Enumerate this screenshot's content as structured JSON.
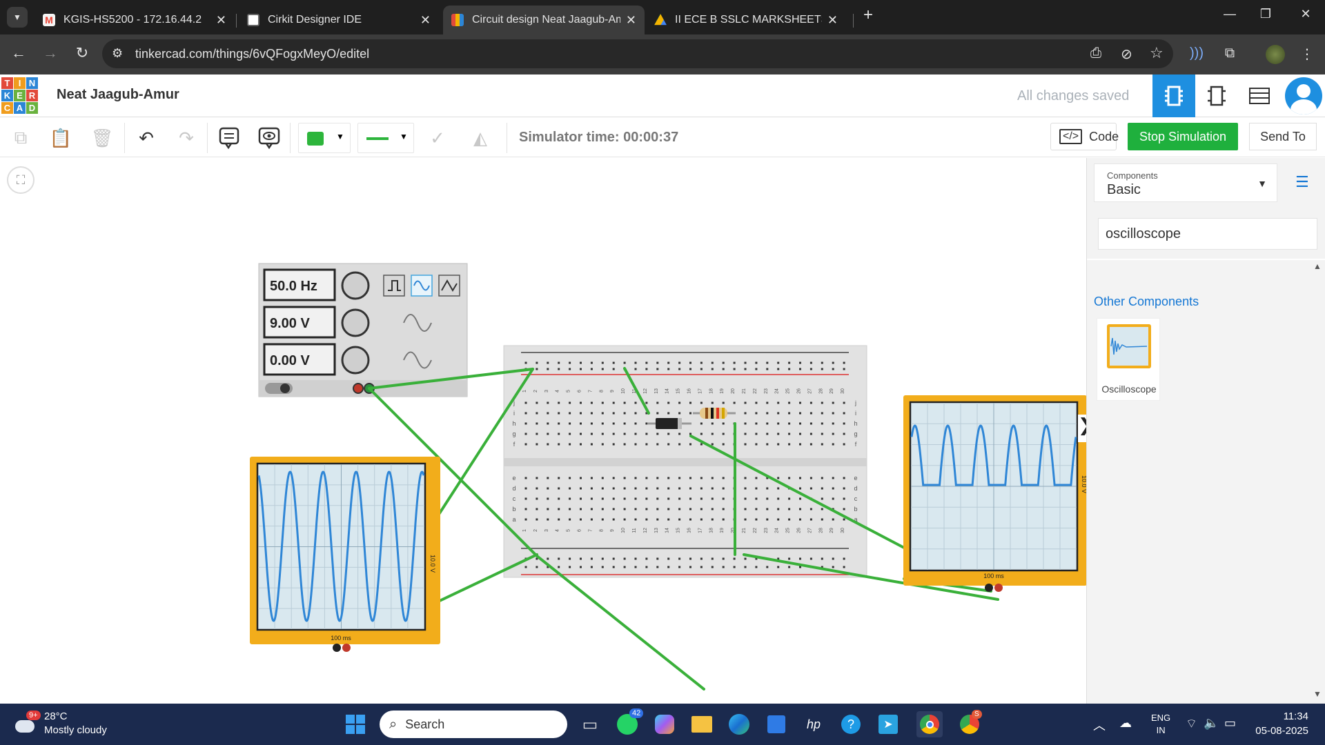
{
  "browser": {
    "tabs": [
      {
        "title": "KGIS-HS5200 - 172.16.44.2",
        "icon": "gmail-icon",
        "active": false
      },
      {
        "title": "Cirkit Designer IDE",
        "icon": "cirkit-icon",
        "active": false
      },
      {
        "title": "Circuit design Neat Jaagub-Amur",
        "icon": "tinkercad-icon",
        "active": true
      },
      {
        "title": "II ECE B SSLC MARKSHEETS - Go",
        "icon": "drive-icon",
        "active": false
      }
    ],
    "url": "tinkercad.com/things/6vQFogxMeyO/editel"
  },
  "header": {
    "logo_letters": [
      "T",
      "I",
      "N",
      "K",
      "E",
      "R",
      "C",
      "A",
      "D"
    ],
    "project_title": "Neat Jaagub-Amur",
    "save_status": "All changes saved"
  },
  "toolbar": {
    "simulator_time": "Simulator time: 00:00:37",
    "code_label": "Code",
    "stop_label": "Stop Simulation",
    "send_label": "Send To",
    "color_swatch": "#2db53c"
  },
  "function_generator": {
    "frequency": "50.0 Hz",
    "amplitude": "9.00 V",
    "offset": "0.00 V"
  },
  "breadboard": {
    "columns": [
      "1",
      "2",
      "3",
      "4",
      "5",
      "6",
      "7",
      "8",
      "9",
      "10",
      "11",
      "12",
      "13",
      "14",
      "15",
      "16",
      "17",
      "18",
      "19",
      "20",
      "21",
      "22",
      "23",
      "24",
      "25",
      "26",
      "27",
      "28",
      "29",
      "30"
    ],
    "rows_top": [
      "j",
      "i",
      "h",
      "g",
      "f"
    ],
    "rows_bottom": [
      "e",
      "d",
      "c",
      "b",
      "a"
    ]
  },
  "oscilloscope_left": {
    "time_label": "100 ms",
    "volt_label": "10.0 V"
  },
  "oscilloscope_right": {
    "time_label": "100 ms",
    "volt_label": "10.0 V"
  },
  "panel": {
    "components_label": "Components",
    "components_value": "Basic",
    "search_value": "oscilloscope",
    "other_components": "Other Components",
    "result_name": "Oscilloscope"
  },
  "taskbar": {
    "weather_badge": "9+",
    "temperature": "28°C",
    "condition": "Mostly cloudy",
    "search_placeholder": "Search",
    "whatsapp_badge": "42",
    "chrome_badge": "S",
    "lang_top": "ENG",
    "lang_bottom": "IN",
    "time": "11:34",
    "date": "05-08-2025"
  },
  "colors": {
    "wire": "#3ab03a",
    "scope_frame": "#f2ad1b",
    "trace": "#2f86d6",
    "stop_button": "#1fb03d",
    "link": "#1477d4"
  }
}
